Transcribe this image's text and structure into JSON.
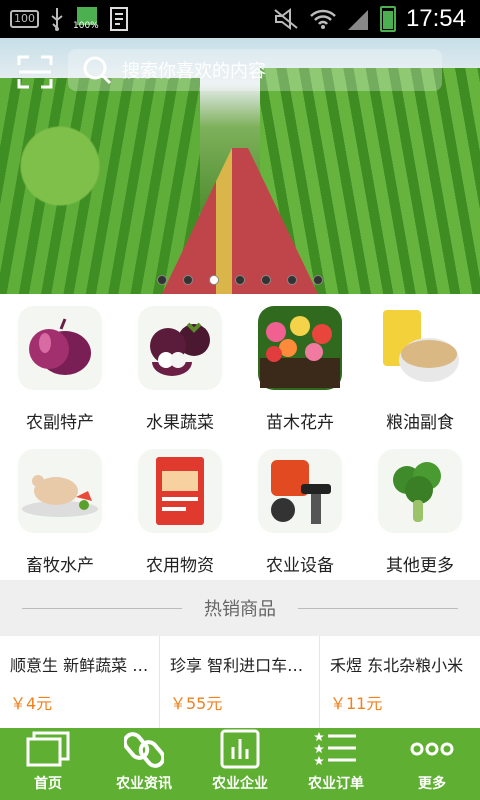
{
  "status_bar": {
    "left_box": "100",
    "battery_percent": "100%",
    "time": "17:54"
  },
  "search": {
    "placeholder": "搜索你喜欢的内容"
  },
  "banner": {
    "slide_count": 7,
    "active_slide": 3
  },
  "categories": [
    {
      "label": "农副特产",
      "icon": "onion-icon"
    },
    {
      "label": "水果蔬菜",
      "icon": "mangosteen-icon"
    },
    {
      "label": "苗木花卉",
      "icon": "flowers-icon"
    },
    {
      "label": "粮油副食",
      "icon": "grain-icon"
    },
    {
      "label": "畜牧水产",
      "icon": "poultry-icon"
    },
    {
      "label": "农用物资",
      "icon": "fertilizer-bag-icon"
    },
    {
      "label": "农业设备",
      "icon": "brush-cutter-icon"
    },
    {
      "label": "其他更多",
      "icon": "broccoli-icon"
    }
  ],
  "hot": {
    "title": "热销商品",
    "products": [
      {
        "name": "顺意生 新鲜蔬菜 大番茄",
        "price": "￥4元"
      },
      {
        "name": "珍享 智利进口车厘子",
        "price": "￥55元"
      },
      {
        "name": "禾煜 东北杂粮小米",
        "price": "￥11元"
      }
    ]
  },
  "tabs": [
    {
      "label": "首页",
      "icon": "home-windows-icon"
    },
    {
      "label": "农业资讯",
      "icon": "link-icon"
    },
    {
      "label": "农业企业",
      "icon": "bar-chart-icon"
    },
    {
      "label": "农业订单",
      "icon": "star-list-icon"
    },
    {
      "label": "更多",
      "icon": "more-dots-icon"
    }
  ],
  "colors": {
    "tabbar": "#5fb032",
    "price": "#f0821e",
    "statusbar": "#000000"
  }
}
